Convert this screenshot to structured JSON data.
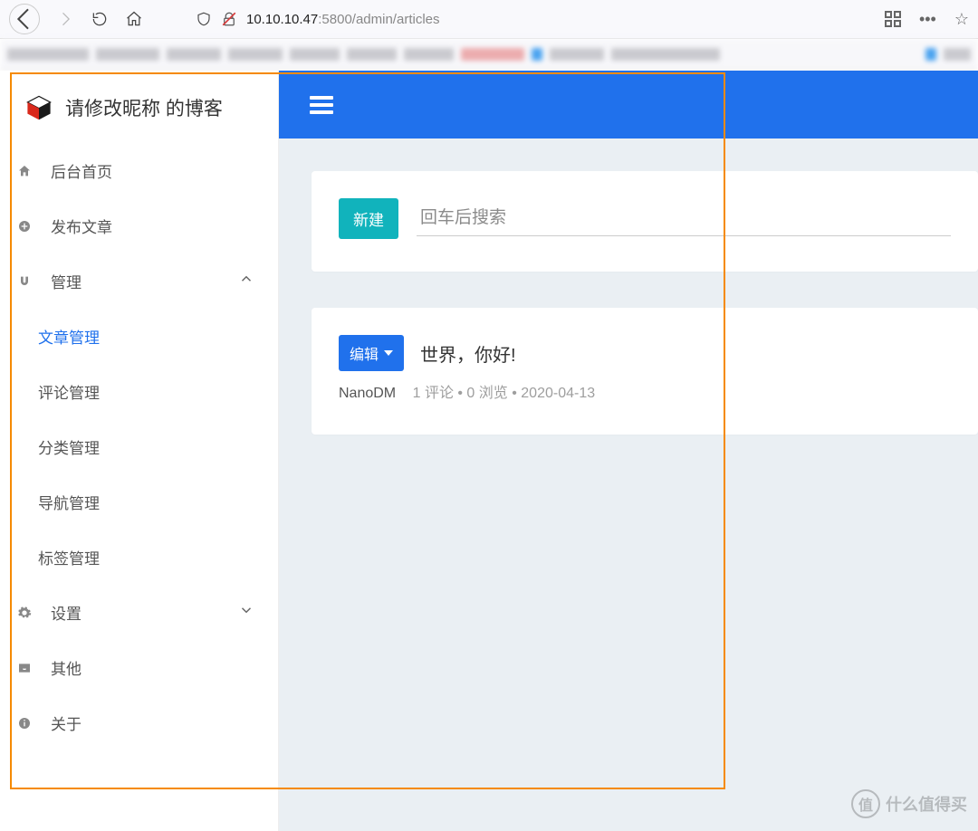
{
  "browser": {
    "url_prefix": "10.10.10.47",
    "url_suffix": ":5800/admin/articles"
  },
  "site": {
    "title": "请修改昵称 的博客"
  },
  "sidebar": {
    "home": "后台首页",
    "publish": "发布文章",
    "manage": "管理",
    "sub": {
      "articles": "文章管理",
      "comments": "评论管理",
      "categories": "分类管理",
      "navigation": "导航管理",
      "tags": "标签管理"
    },
    "settings": "设置",
    "other": "其他",
    "about": "关于"
  },
  "main": {
    "new_button": "新建",
    "search_placeholder": "回车后搜索",
    "edit_button": "编辑",
    "article_title": "世界，你好!",
    "author": "NanoDM",
    "meta": "1 评论 • 0 浏览 • 2020-04-13"
  },
  "watermark": {
    "symbol": "值",
    "text": "什么值得买"
  }
}
